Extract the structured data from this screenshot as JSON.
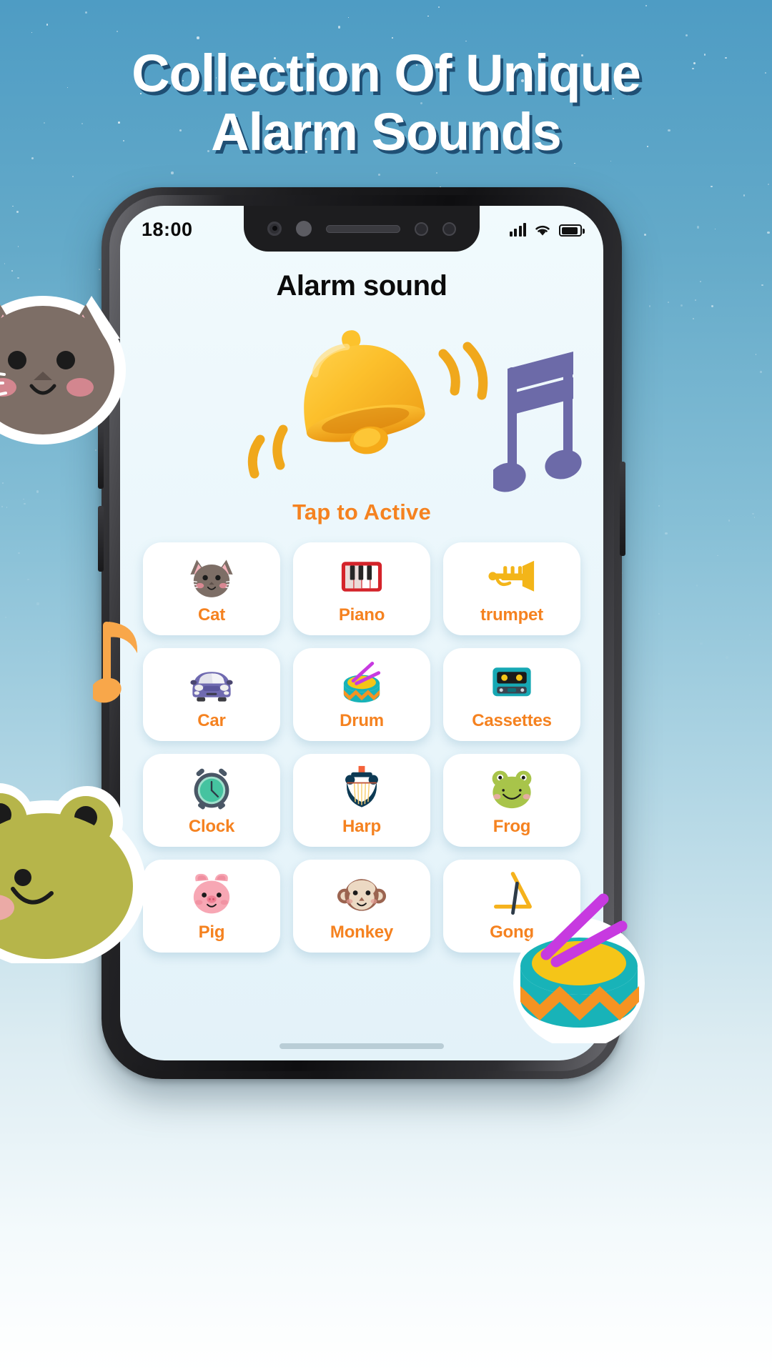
{
  "promo": {
    "headline_line1": "Collection Of Unique",
    "headline_line2": "Alarm Sounds",
    "headline_color": "#ffffff",
    "headline_shadow_color": "#1f4f74",
    "background_top_color": "#4e9cc4",
    "background_bottom_color": "#ffffff"
  },
  "phone": {
    "status_bar": {
      "time": "18:00",
      "signal_icon": "signal-bars-icon",
      "wifi_icon": "wifi-icon",
      "battery_icon": "battery-icon"
    },
    "home_indicator": "home-indicator"
  },
  "app": {
    "title": "Alarm sound",
    "hero_icon": "bell-icon",
    "tap_label": "Tap to Active",
    "accent_color": "#f58220",
    "title_color": "#0b0b0b",
    "screen_background": "#eaf6fb",
    "sounds": [
      {
        "label": "Cat",
        "icon": "cat-icon"
      },
      {
        "label": "Piano",
        "icon": "piano-icon"
      },
      {
        "label": "trumpet",
        "icon": "trumpet-icon"
      },
      {
        "label": "Car",
        "icon": "car-icon"
      },
      {
        "label": "Drum",
        "icon": "drum-icon"
      },
      {
        "label": "Cassettes",
        "icon": "cassette-icon"
      },
      {
        "label": "Clock",
        "icon": "alarm-clock-icon"
      },
      {
        "label": "Harp",
        "icon": "harp-icon"
      },
      {
        "label": "Frog",
        "icon": "frog-icon"
      },
      {
        "label": "Pig",
        "icon": "pig-icon"
      },
      {
        "label": "Monkey",
        "icon": "monkey-icon"
      },
      {
        "label": "Gong",
        "icon": "gong-icon"
      }
    ]
  },
  "decorations": [
    {
      "name": "cat-sticker"
    },
    {
      "name": "frog-sticker"
    },
    {
      "name": "purple-music-note"
    },
    {
      "name": "orange-music-note"
    },
    {
      "name": "drum-sticker"
    }
  ]
}
